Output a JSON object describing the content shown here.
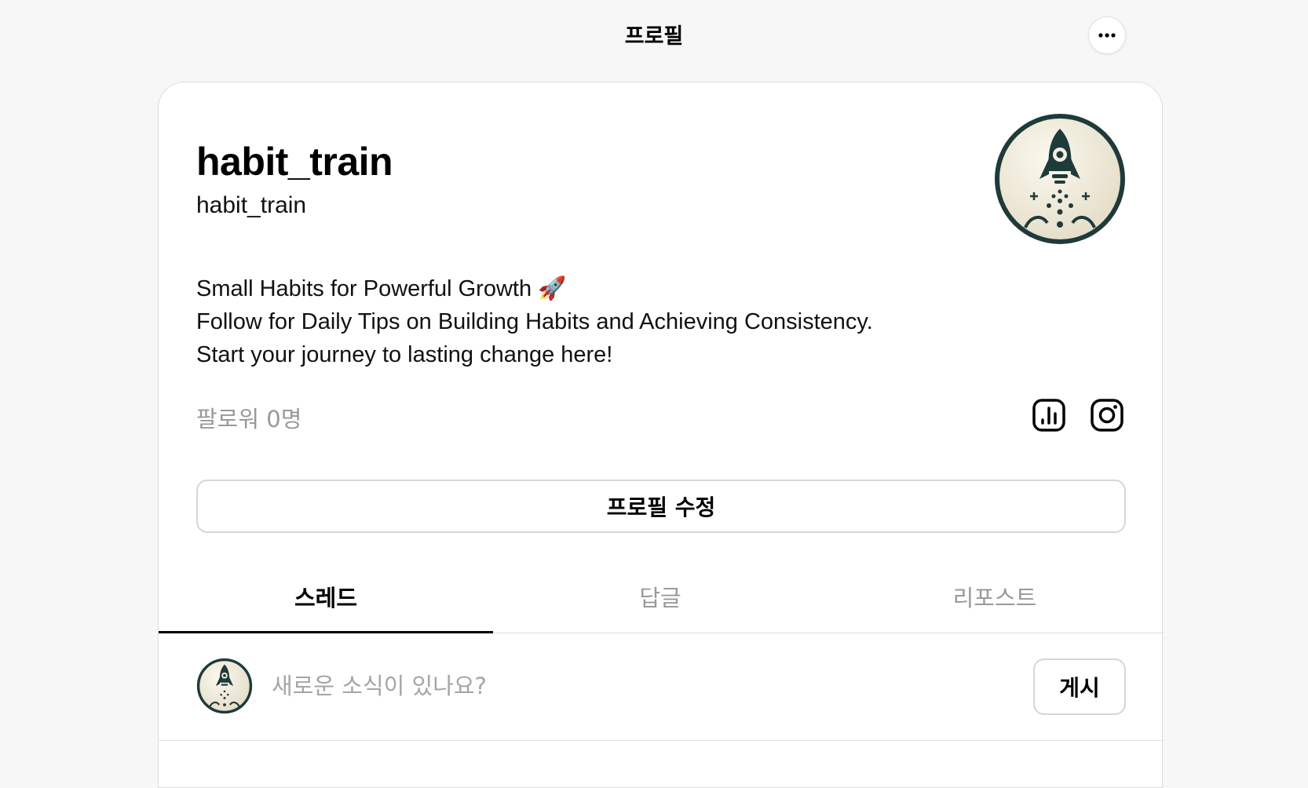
{
  "header": {
    "title": "프로필",
    "more_icon": "more-horizontal-icon"
  },
  "profile": {
    "display_name": "habit_train",
    "username": "habit_train",
    "avatar_icon": "rocket-avatar",
    "bio": [
      "Small Habits for Powerful Growth 🚀",
      "Follow for Daily Tips on Building Habits and Achieving Consistency.",
      "Start your journey to lasting change here!"
    ],
    "followers": "팔로워 0명",
    "insights_icon": "bar-chart-icon",
    "instagram_icon": "instagram-icon",
    "edit_label": "프로필 수정"
  },
  "tabs": [
    {
      "label": "스레드",
      "active": true
    },
    {
      "label": "답글",
      "active": false
    },
    {
      "label": "리포스트",
      "active": false
    }
  ],
  "composer": {
    "placeholder": "새로운 소식이 있나요?",
    "post_label": "게시"
  }
}
